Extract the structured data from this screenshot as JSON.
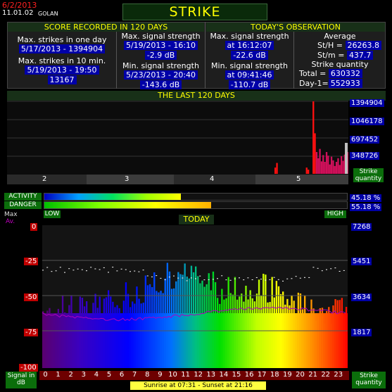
{
  "header": {
    "date": "6/2/2013",
    "version": "11.01.02",
    "location": "GOLAN",
    "title": "STRIKE HISTOGRAM"
  },
  "score": {
    "section_title": "SCORE RECORDED IN 120 DAYS",
    "max_strikes_day_label": "Max. strikes in one day",
    "max_strikes_day_value": "5/17/2013 - 1394904",
    "max_strikes_10min_label": "Max. strikes in 10 min.",
    "max_strikes_10min_date": "5/19/2013 - 19:50",
    "max_strikes_10min_value": "13167",
    "max_signal_label": "Max. signal strength",
    "max_signal_date": "5/19/2013 - 16:10",
    "max_signal_value": "-2.9 dB",
    "min_signal_label": "Min. signal strength",
    "min_signal_date": "5/23/2013 - 20:40",
    "min_signal_value": "-143.6 dB"
  },
  "today": {
    "section_title": "TODAY'S OBSERVATION",
    "max_signal_label": "Max. signal strength",
    "max_signal_time": "at 16:12:07",
    "max_signal_value": "-22.6 dB",
    "min_signal_label": "Min. signal strength",
    "min_signal_time": "at 09:41:46",
    "min_signal_value": "-110.7 dB",
    "average_label": "Average",
    "sth_label": "St/H =",
    "sth_value": "26263.8",
    "stm_label": "St/m =",
    "stm_value": "437.7",
    "strike_quantity_label": "Strike quantity",
    "total_label": "Total  =",
    "total_value": "630332",
    "day1_label": "Day-1=",
    "day1_value": "552933"
  },
  "last120": {
    "title": "THE LAST 120 DAYS",
    "y_ticks": [
      "1394904",
      "1046178",
      "697452",
      "348726"
    ],
    "month_labels": [
      "2",
      "3",
      "4",
      "5"
    ],
    "y_axis_label": "Strike quantity"
  },
  "bars": {
    "activity_label": "ACTIVITY",
    "activity_value": "45.18 %",
    "activity_fraction": 0.4518,
    "danger_label": "DANGER",
    "danger_value": "55.18 %",
    "danger_fraction": 0.5518,
    "low_label": "LOW",
    "high_label": "HIGH"
  },
  "todaychart": {
    "title": "TODAY",
    "legend_max": "Max",
    "legend_av": "Av.",
    "left_ticks": [
      "0",
      "-25",
      "-50",
      "-75",
      "-100"
    ],
    "right_ticks": [
      "7268",
      "5451",
      "3634",
      "1817"
    ],
    "hours": [
      "0",
      "1",
      "2",
      "3",
      "4",
      "5",
      "6",
      "7",
      "8",
      "9",
      "10",
      "11",
      "12",
      "13",
      "14",
      "15",
      "16",
      "17",
      "18",
      "19",
      "20",
      "21",
      "22",
      "23"
    ],
    "left_axis_label": "Signal in dB",
    "right_axis_label": "Strike quantity",
    "sun_text": "Sunrise at 07:31  -  Sunset at 21:16"
  },
  "chart_data": [
    {
      "type": "bar",
      "title": "THE LAST 120 DAYS",
      "ylabel": "Strike quantity",
      "ylim": [
        0,
        1394904
      ],
      "x": [
        "2",
        "3",
        "4",
        "5"
      ],
      "values_last_days": [
        120000,
        210000,
        0,
        0,
        0,
        0,
        0,
        0,
        0,
        0,
        0,
        0,
        0,
        0,
        0,
        0,
        0,
        0,
        0,
        120000,
        80000,
        0,
        0,
        1394904,
        780000,
        420000,
        300000,
        480000,
        240000,
        360000,
        230000,
        420000,
        350000,
        180000,
        330000,
        260000,
        150000,
        230000,
        300000,
        170000,
        340000,
        250000,
        370000,
        500000,
        420000
      ]
    },
    {
      "type": "bar",
      "title": "TODAY",
      "xlabel": "",
      "ylabel": "Signal in dB",
      "ylim": [
        -100,
        0
      ],
      "x_range": [
        0,
        24
      ],
      "max_series_approx": "bars from -100 dB rising to about -20 dB peak near 10-11h",
      "y2lim": [
        0,
        7268
      ]
    }
  ],
  "colors": {
    "accent_yellow": "#ffff00",
    "axis_blue": "#0000a8",
    "axis_red": "#c00000",
    "header_green": "#183018"
  }
}
